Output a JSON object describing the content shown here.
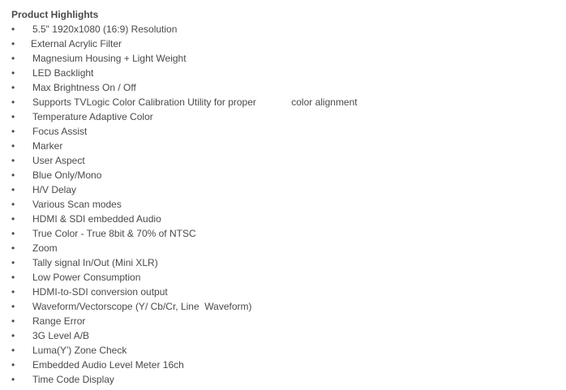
{
  "heading": "Product Highlights",
  "bullet_glyph": "•",
  "items": [
    "5.5\" 1920x1080 (16:9) Resolution",
    "External Acrylic Filter",
    "Magnesium Housing + Light Weight",
    "LED Backlight",
    "Max Brightness On / Off",
    "Supports TVLogic Color Calibration Utility for proper             color alignment",
    "Temperature Adaptive Color",
    "Focus Assist",
    "Marker",
    "User Aspect",
    "Blue Only/Mono",
    "H/V Delay",
    "Various Scan modes",
    "HDMI & SDI embedded Audio",
    "True Color - True 8bit & 70% of NTSC",
    "Zoom",
    "Tally signal In/Out (Mini XLR)",
    "Low Power Consumption",
    "HDMI-to-SDI conversion output",
    "Waveform/Vectorscope (Y/ Cb/Cr, Line  Waveform)",
    "Range Error",
    "3G Level A/B",
    "Luma(Y') Zone Check",
    "Embedded Audio Level Meter 16ch",
    "Time Code Display"
  ]
}
